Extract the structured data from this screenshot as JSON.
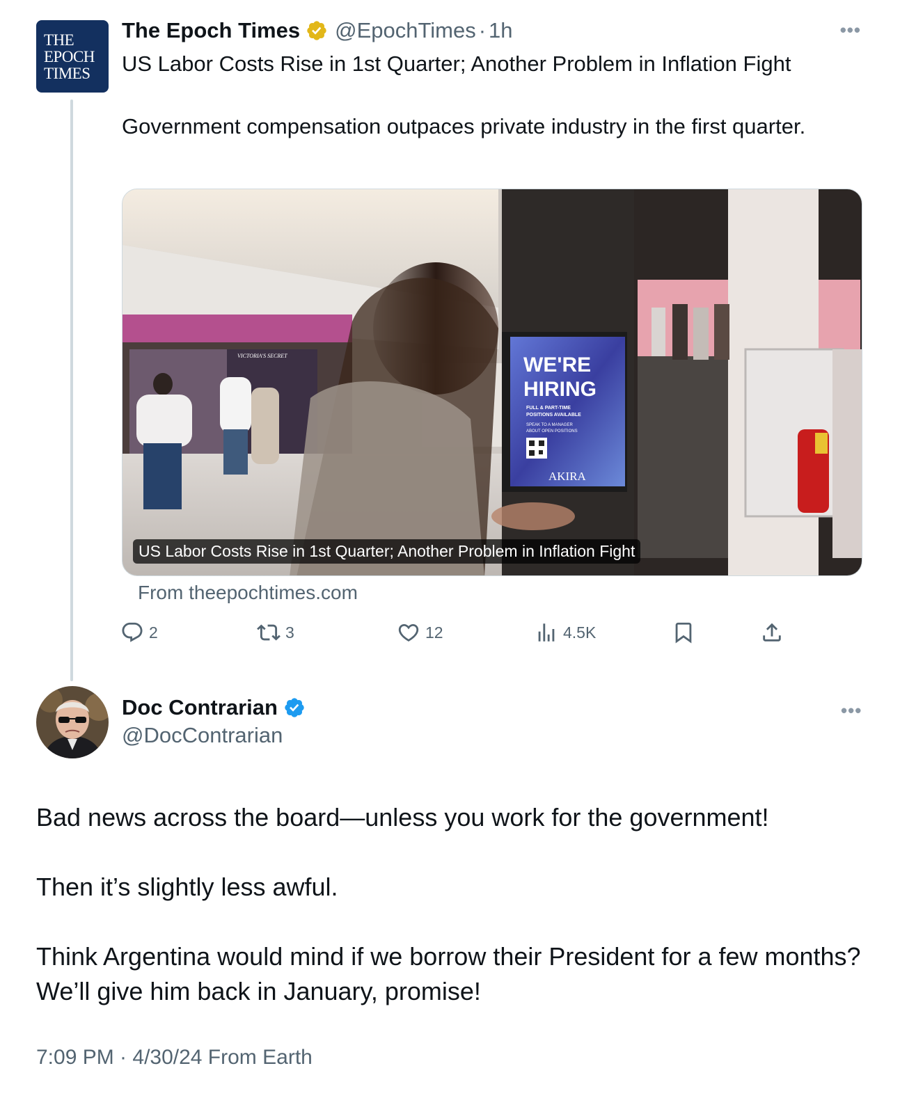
{
  "quoted_tweet": {
    "avatar_lines": [
      "THE",
      "EPOCH",
      "TIMES"
    ],
    "display_name": "The Epoch Times",
    "verified_badge": "gold-verified-badge-icon",
    "handle": "@EpochTimes",
    "separator": "·",
    "time": "1h",
    "more_icon": "more-horizontal-icon",
    "text_line1": "US Labor Costs Rise in 1st Quarter; Another Problem in Inflation Fight",
    "text_line2": "Government compensation outpaces private industry in the first quarter.",
    "card": {
      "sign_lines": [
        "WE'RE",
        "HIRING"
      ],
      "sign_small": [
        "FULL & PART-TIME",
        "POSITIONS AVAILABLE",
        "SPEAK TO A MANAGER",
        "ABOUT OPEN POSITIONS"
      ],
      "sign_brand": "AKIRA",
      "store_sign": "VICTORIA'S SECRET",
      "caption": "US Labor Costs Rise in 1st Quarter; Another Problem in Inflation Fight",
      "source": "From theepochtimes.com"
    },
    "actions": {
      "replies": "2",
      "reposts": "3",
      "likes": "12",
      "views": "4.5K"
    }
  },
  "main_tweet": {
    "display_name": "Doc Contrarian",
    "verified_badge": "blue-verified-badge-icon",
    "handle": "@DocContrarian",
    "more_icon": "more-horizontal-icon",
    "paragraphs": [
      "Bad news across the board—unless you work for the government!",
      "Then it’s slightly less awful.",
      "Think Argentina would mind if we borrow their President for a few months? We’ll give him back in January, promise!"
    ],
    "timestamp": "7:09 PM · 4/30/24 From Earth"
  },
  "colors": {
    "epoch_blue": "#13305f",
    "gold_badge": "#e2b719",
    "blue_badge": "#1d9bf0",
    "secondary_text": "#536471",
    "thread_line": "#cfd9de"
  }
}
